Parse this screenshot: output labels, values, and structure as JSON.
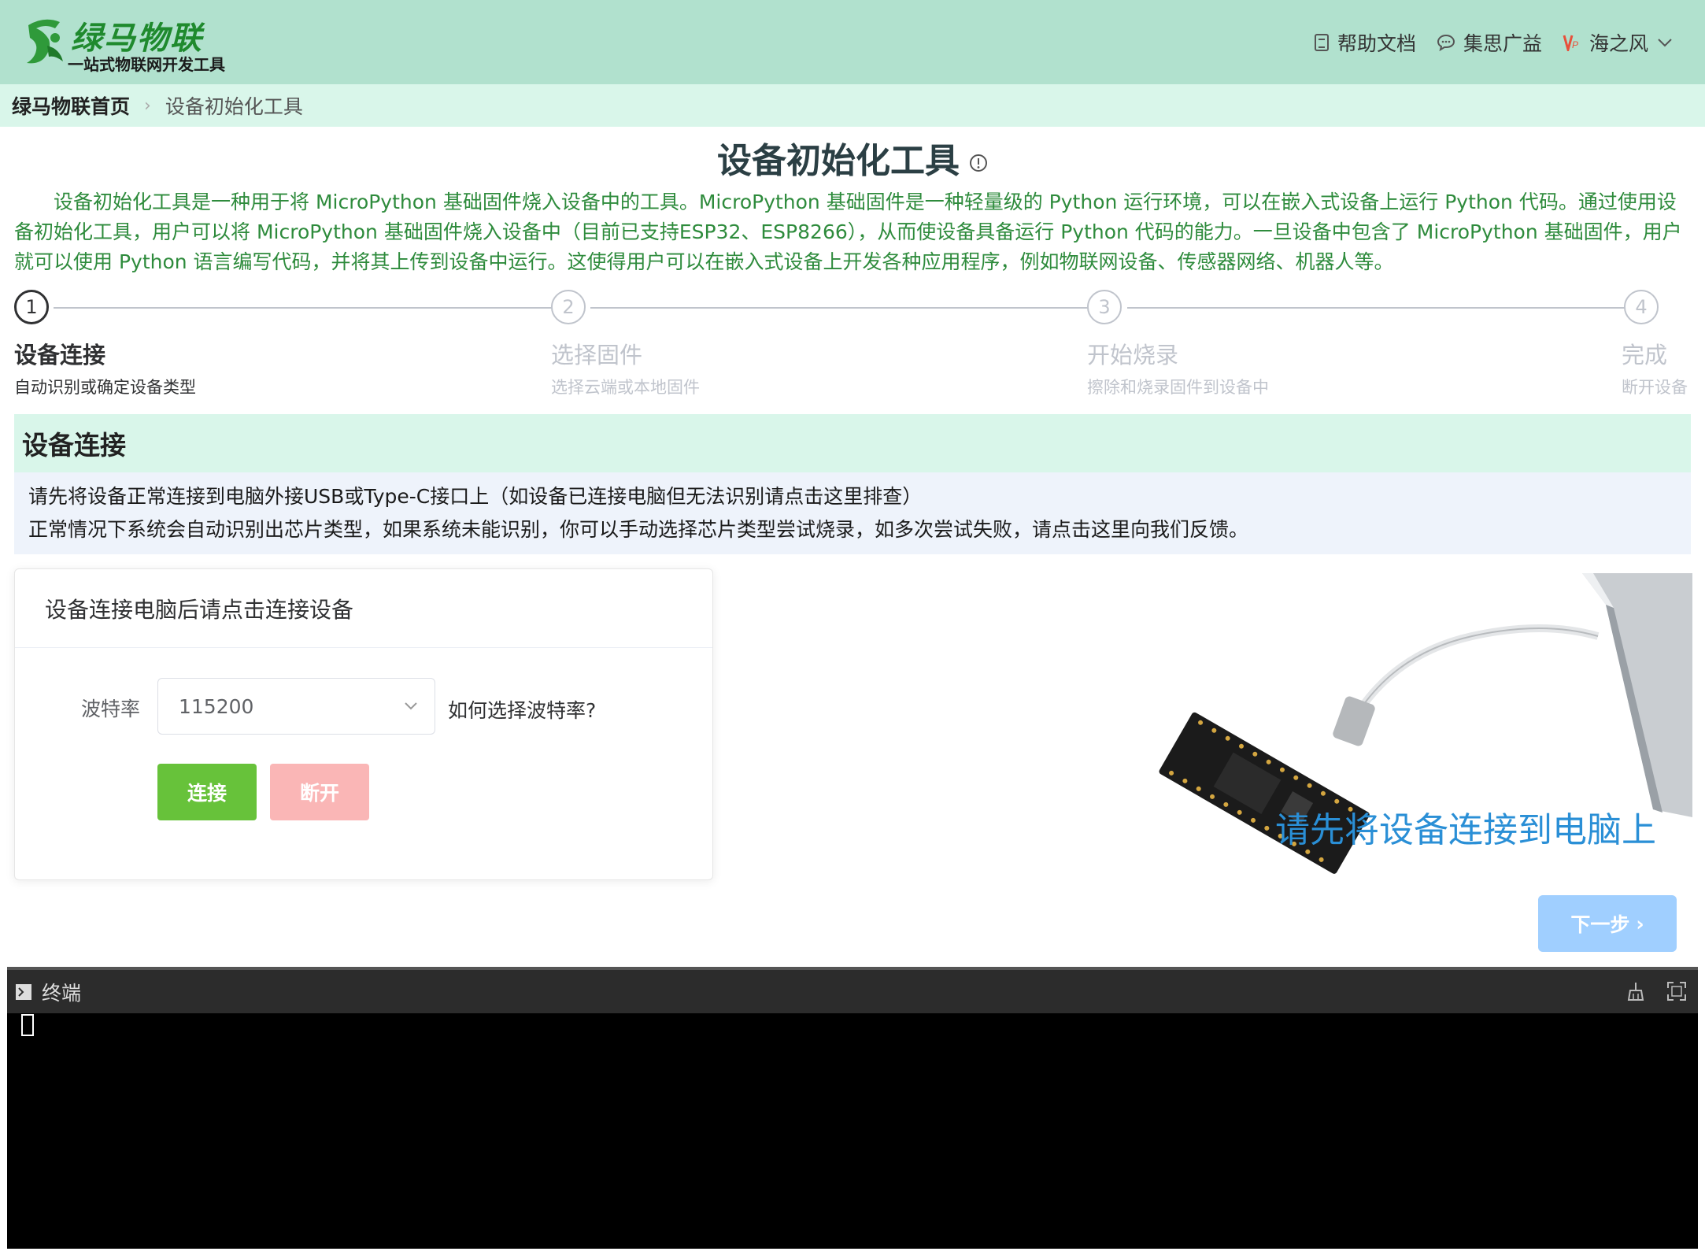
{
  "header": {
    "logo_title": "绿马物联",
    "logo_subtitle": "一站式物联网开发工具",
    "nav": [
      {
        "label": "帮助文档",
        "icon": "document-icon"
      },
      {
        "label": "集思广益",
        "icon": "chat-icon"
      }
    ],
    "user": {
      "name": "海之风",
      "badge_icon": "vip-icon"
    }
  },
  "breadcrumb": {
    "home": "绿马物联首页",
    "current": "设备初始化工具"
  },
  "page": {
    "title": "设备初始化工具",
    "intro": "设备初始化工具是一种用于将 MicroPython 基础固件烧入设备中的工具。MicroPython 基础固件是一种轻量级的 Python 运行环境，可以在嵌入式设备上运行 Python 代码。通过使用设备初始化工具，用户可以将 MicroPython 基础固件烧入设备中（目前已支持ESP32、ESP8266），从而使设备具备运行 Python 代码的能力。一旦设备中包含了 MicroPython 基础固件，用户就可以使用 Python 语言编写代码，并将其上传到设备中运行。这使得用户可以在嵌入式设备上开发各种应用程序，例如物联网设备、传感器网络、机器人等。"
  },
  "steps": [
    {
      "number": "1",
      "title": "设备连接",
      "desc": "自动识别或确定设备类型",
      "active": true
    },
    {
      "number": "2",
      "title": "选择固件",
      "desc": "选择云端或本地固件",
      "active": false
    },
    {
      "number": "3",
      "title": "开始烧录",
      "desc": "擦除和烧录固件到设备中",
      "active": false
    },
    {
      "number": "4",
      "title": "完成",
      "desc": "断开设备",
      "active": false
    }
  ],
  "section": {
    "title": "设备连接",
    "notice_line1": "请先将设备正常连接到电脑外接USB或Type-C接口上（如设备已连接电脑但无法识别请点击这里排查）",
    "notice_line2": "正常情况下系统会自动识别出芯片类型，如果系统未能识别，你可以手动选择芯片类型尝试烧录，如多次尝试失败，请点击这里向我们反馈。"
  },
  "card": {
    "header": "设备连接电脑后请点击连接设备",
    "baud_label": "波特率",
    "baud_value": "115200",
    "baud_help": "如何选择波特率?",
    "connect_label": "连接",
    "disconnect_label": "断开"
  },
  "illustration": {
    "caption": "请先将设备连接到电脑上"
  },
  "next_label": "下一步",
  "terminal": {
    "title": "终端"
  }
}
